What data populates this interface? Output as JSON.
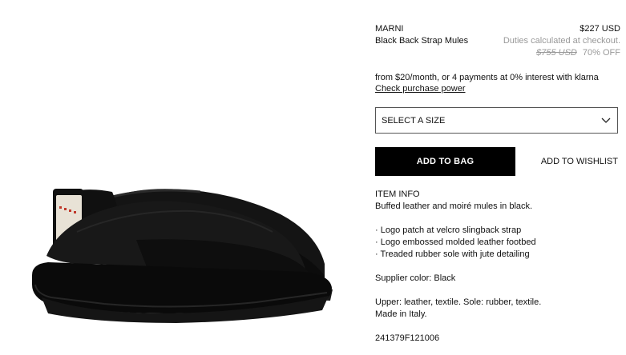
{
  "product": {
    "brand": "MARNI",
    "name": "Black Back Strap Mules",
    "price": "$227 USD",
    "duties_note": "Duties calculated at checkout.",
    "original_price": "$755 USD",
    "discount": "70% OFF"
  },
  "klarna": {
    "message": "from $20/month, or 4 payments at 0% interest with klarna",
    "link_label": "Check purchase power"
  },
  "size_select": {
    "label": "SELECT A SIZE",
    "icon": "chevron-down-icon"
  },
  "actions": {
    "add_to_bag": "ADD TO BAG",
    "add_to_wishlist": "ADD TO WISHLIST"
  },
  "item_info": {
    "heading": "ITEM INFO",
    "description": "Buffed leather and moiré mules in black.",
    "bullets": [
      "· Logo patch at velcro slingback strap",
      "· Logo embossed molded leather footbed",
      "· Treaded rubber sole with jute detailing"
    ],
    "supplier_color": "Supplier color: Black",
    "materials": "Upper: leather, textile. Sole: rubber, textile.",
    "origin": "Made in Italy.",
    "sku": "241379F121006"
  },
  "colors": {
    "button_bg": "#000000",
    "button_text": "#ffffff",
    "muted_text": "#999999",
    "shoe": "#111111",
    "strap_patch": "#e8e2d6",
    "logo_red": "#c0392b"
  }
}
